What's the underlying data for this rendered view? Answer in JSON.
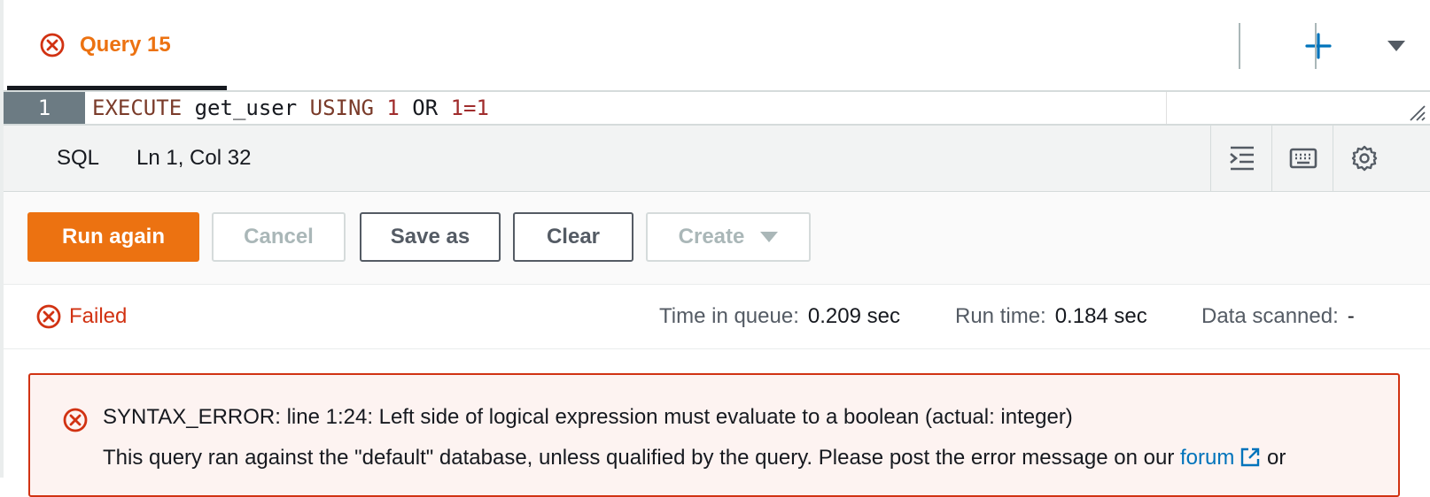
{
  "tab": {
    "label": "Query 15",
    "status_icon": "error-circle-icon"
  },
  "toolbar_icons": {
    "add": "plus-icon",
    "more": "caret-down-icon"
  },
  "editor": {
    "line_number": "1",
    "tokens": [
      {
        "text": "EXECUTE",
        "type": "kw"
      },
      {
        "text": " get_user ",
        "type": "plain"
      },
      {
        "text": "USING",
        "type": "kw"
      },
      {
        "text": " ",
        "type": "plain"
      },
      {
        "text": "1",
        "type": "num"
      },
      {
        "text": " OR ",
        "type": "plain"
      },
      {
        "text": "1=1",
        "type": "num"
      }
    ]
  },
  "status_bar": {
    "language": "SQL",
    "position": "Ln 1, Col 32",
    "icons": [
      "format-indent-icon",
      "keyboard-icon",
      "settings-gear-icon"
    ]
  },
  "actions": {
    "run_again": "Run again",
    "cancel": "Cancel",
    "save_as": "Save as",
    "clear": "Clear",
    "create": "Create"
  },
  "result": {
    "status": "Failed",
    "time_in_queue_label": "Time in queue:",
    "time_in_queue_value": "0.209 sec",
    "run_time_label": "Run time:",
    "run_time_value": "0.184 sec",
    "data_scanned_label": "Data scanned:",
    "data_scanned_value": "-"
  },
  "error": {
    "title": "SYNTAX_ERROR: line 1:24: Left side of logical expression must evaluate to a boolean (actual: integer)",
    "body_prefix": "This query ran against the \"default\" database, unless qualified by the query. Please post the error message on our ",
    "link_text": "forum",
    "body_suffix": " or"
  },
  "colors": {
    "accent_orange": "#ec7211",
    "error_red": "#d13212",
    "link_blue": "#0073bb",
    "error_bg": "#fdf3f1"
  }
}
